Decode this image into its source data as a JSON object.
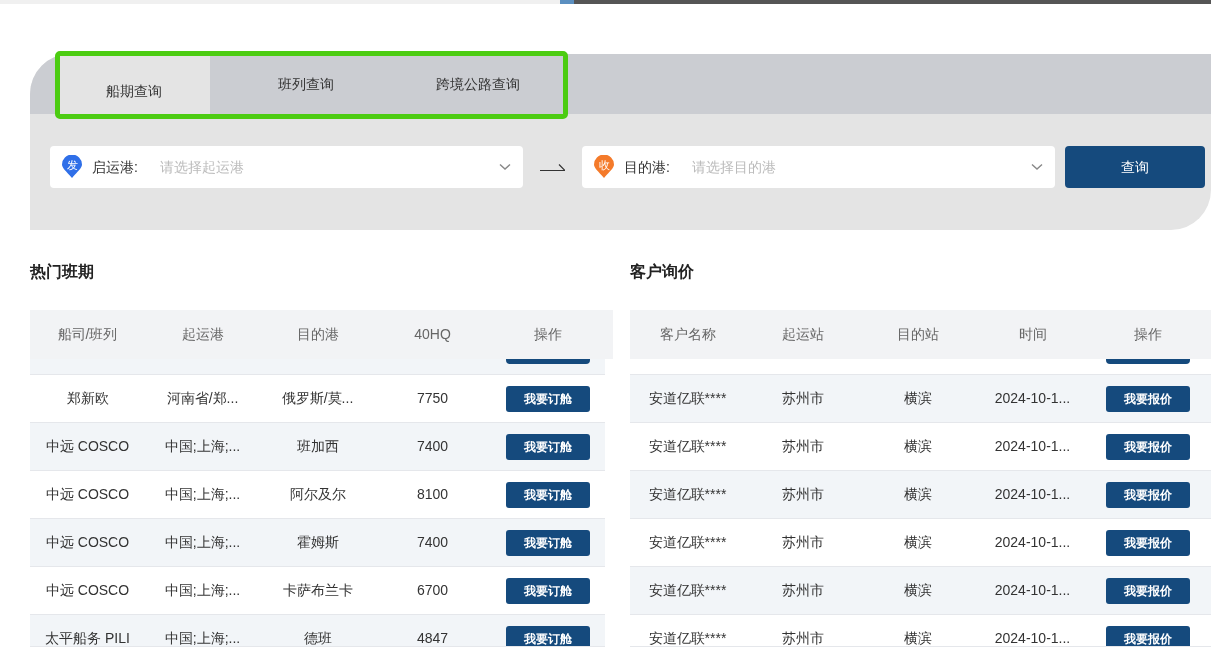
{
  "search_panel": {
    "tabs": [
      {
        "label": "船期查询",
        "selected": true
      },
      {
        "label": "班列查询",
        "selected": false
      },
      {
        "label": "跨境公路查询",
        "selected": false
      }
    ],
    "origin": {
      "label": "启运港:",
      "badge": "发",
      "placeholder": "请选择起运港"
    },
    "destination": {
      "label": "目的港:",
      "badge": "收",
      "placeholder": "请选择目的港"
    },
    "search_button": "查询"
  },
  "hot_schedules": {
    "title": "热门班期",
    "columns": [
      "船司/班列",
      "起运港",
      "目的港",
      "40HQ",
      "操作"
    ],
    "rows": [
      {
        "carrier": "郑新欧",
        "origin": "河南省/郑...",
        "destination": "俄罗斯/莫...",
        "price": "7750",
        "action": "我要订舱"
      },
      {
        "carrier": "中远 COSCO",
        "origin": "中国;上海;...",
        "destination": "班加西",
        "price": "7400",
        "action": "我要订舱"
      },
      {
        "carrier": "中远 COSCO",
        "origin": "中国;上海;...",
        "destination": "阿尔及尔",
        "price": "8100",
        "action": "我要订舱"
      },
      {
        "carrier": "中远 COSCO",
        "origin": "中国;上海;...",
        "destination": "霍姆斯",
        "price": "7400",
        "action": "我要订舱"
      },
      {
        "carrier": "中远 COSCO",
        "origin": "中国;上海;...",
        "destination": "卡萨布兰卡",
        "price": "6700",
        "action": "我要订舱"
      },
      {
        "carrier": "太平船务 PILI",
        "origin": "中国;上海;...",
        "destination": "德班",
        "price": "4847",
        "action": "我要订舱"
      }
    ]
  },
  "customer_inquiries": {
    "title": "客户询价",
    "columns": [
      "客户名称",
      "起运站",
      "目的站",
      "时间",
      "操作"
    ],
    "rows": [
      {
        "customer": "安道亿联****",
        "origin": "苏州市",
        "destination": "横滨",
        "time": "2024-10-1...",
        "action": "我要报价"
      },
      {
        "customer": "安道亿联****",
        "origin": "苏州市",
        "destination": "横滨",
        "time": "2024-10-1...",
        "action": "我要报价"
      },
      {
        "customer": "安道亿联****",
        "origin": "苏州市",
        "destination": "横滨",
        "time": "2024-10-1...",
        "action": "我要报价"
      },
      {
        "customer": "安道亿联****",
        "origin": "苏州市",
        "destination": "横滨",
        "time": "2024-10-1...",
        "action": "我要报价"
      },
      {
        "customer": "安道亿联****",
        "origin": "苏州市",
        "destination": "横滨",
        "time": "2024-10-1...",
        "action": "我要报价"
      },
      {
        "customer": "安道亿联****",
        "origin": "苏州市",
        "destination": "横滨",
        "time": "2024-10-1...",
        "action": "我要报价"
      }
    ]
  }
}
